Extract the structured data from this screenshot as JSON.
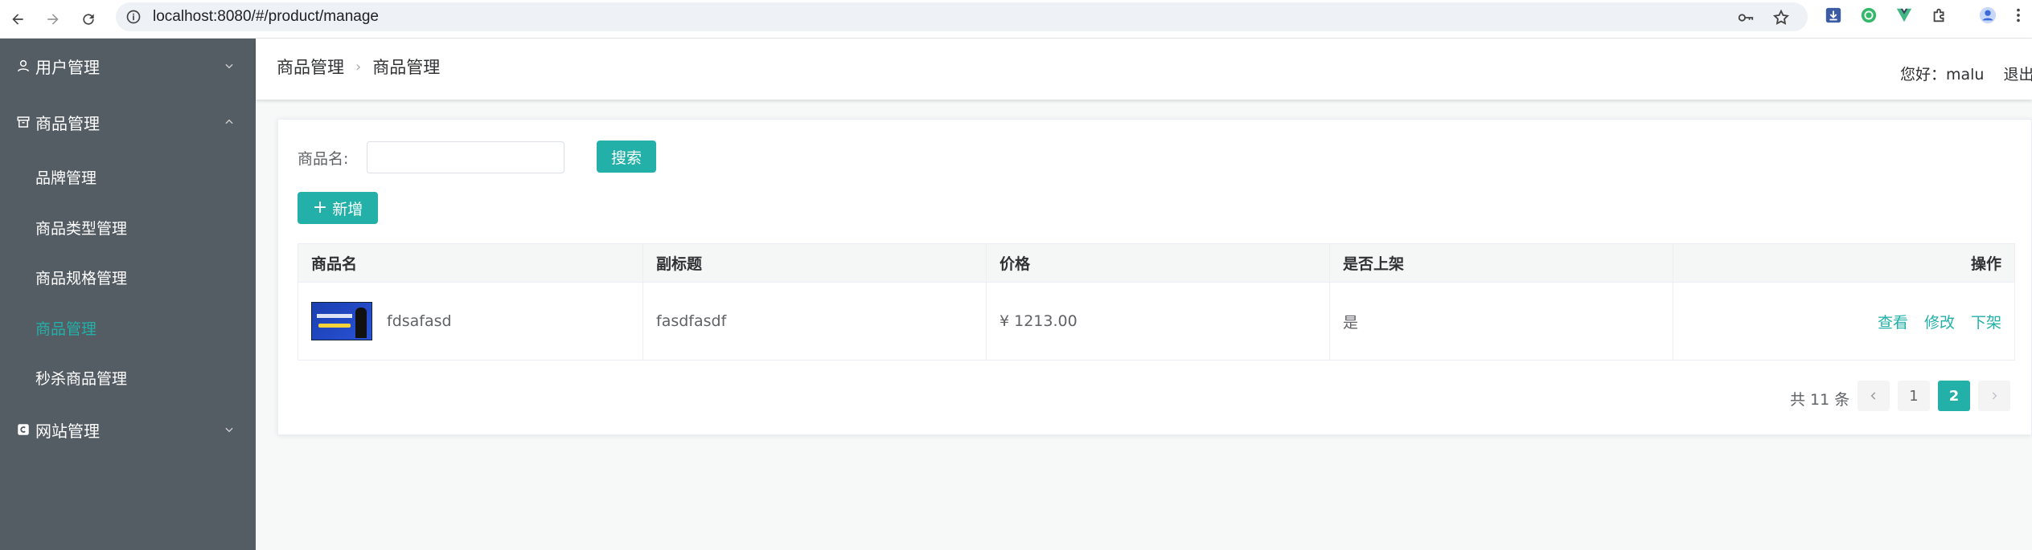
{
  "browser": {
    "url": "localhost:8080/#/product/manage"
  },
  "sidebar": {
    "menus": [
      {
        "label": "用户管理",
        "icon": "user-icon"
      },
      {
        "label": "商品管理",
        "icon": "box-icon"
      },
      {
        "label": "网站管理",
        "icon": "site-icon"
      }
    ],
    "sub_items": [
      {
        "label": "品牌管理"
      },
      {
        "label": "商品类型管理"
      },
      {
        "label": "商品规格管理"
      },
      {
        "label": "商品管理"
      },
      {
        "label": "秒杀商品管理"
      }
    ],
    "active_color": "#22b0a8",
    "bg_color": "#545c64"
  },
  "header": {
    "breadcrumb": [
      "商品管理",
      "商品管理"
    ],
    "greeting": "您好：malu",
    "logout": "退出"
  },
  "search": {
    "label": "商品名:",
    "value": "",
    "button": "搜索"
  },
  "toolbar": {
    "add_label": "新增"
  },
  "table": {
    "columns": [
      "商品名",
      "副标题",
      "价格",
      "是否上架",
      "操作"
    ],
    "rows": [
      {
        "name": "fdsafasd",
        "subtitle": "fasdfasdf",
        "price": "¥ 1213.00",
        "on_sale": "是",
        "actions": [
          "查看",
          "修改",
          "下架"
        ]
      }
    ]
  },
  "pagination": {
    "total": "共 11 条",
    "pages": [
      "1",
      "2"
    ],
    "current": "2"
  },
  "accent_color": "#22b0a8"
}
